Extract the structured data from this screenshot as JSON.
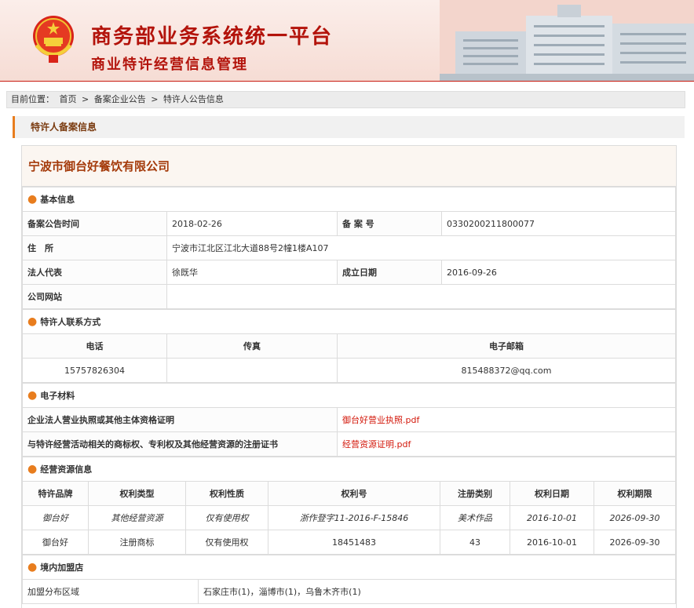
{
  "header": {
    "title": "商务部业务系统统一平台",
    "subtitle": "商业特许经营信息管理"
  },
  "breadcrumb": {
    "prefix": "目前位置：",
    "items": [
      "首页",
      "备案企业公告",
      "特许人公告信息"
    ],
    "separator": ">"
  },
  "section_title": "特许人备案信息",
  "company_name": "宁波市御台好餐饮有限公司",
  "basic": {
    "title": "基本信息",
    "publish_date_label": "备案公告时间",
    "publish_date": "2018-02-26",
    "record_no_label": "备 案 号",
    "record_no": "0330200211800077",
    "address_label": "住　所",
    "address": "宁波市江北区江北大道88号2幢1楼A107",
    "legal_rep_label": "法人代表",
    "legal_rep": "徐既华",
    "founded_label": "成立日期",
    "founded": "2016-09-26",
    "website_label": "公司网站",
    "website": ""
  },
  "contact": {
    "title": "特许人联系方式",
    "phone_label": "电话",
    "fax_label": "传真",
    "email_label": "电子邮箱",
    "phone": "15757826304",
    "fax": "",
    "email": "815488372@qq.com"
  },
  "materials": {
    "title": "电子材料",
    "rows": [
      {
        "label": "企业法人营业执照或其他主体资格证明",
        "file": "御台好营业执照.pdf"
      },
      {
        "label": "与特许经营活动相关的商标权、专利权及其他经营资源的注册证书",
        "file": "经营资源证明.pdf"
      }
    ]
  },
  "resources": {
    "title": "经营资源信息",
    "headers": [
      "特许品牌",
      "权利类型",
      "权利性质",
      "权利号",
      "注册类别",
      "权利日期",
      "权利期限"
    ],
    "rows": [
      [
        "御台好",
        "其他经营资源",
        "仅有使用权",
        "浙作登字11-2016-F-15846",
        "美术作品",
        "2016-10-01",
        "2026-09-30"
      ],
      [
        "御台好",
        "注册商标",
        "仅有使用权",
        "18451483",
        "43",
        "2016-10-01",
        "2026-09-30"
      ]
    ]
  },
  "franchise": {
    "title": "境内加盟店",
    "area_label": "加盟分布区域",
    "area": "石家庄市(1)，淄博市(1)，乌鲁木齐市(1)"
  },
  "colors": {
    "accent": "#e87d1e",
    "brand_red": "#b3130b",
    "link_red": "#d3180b"
  }
}
